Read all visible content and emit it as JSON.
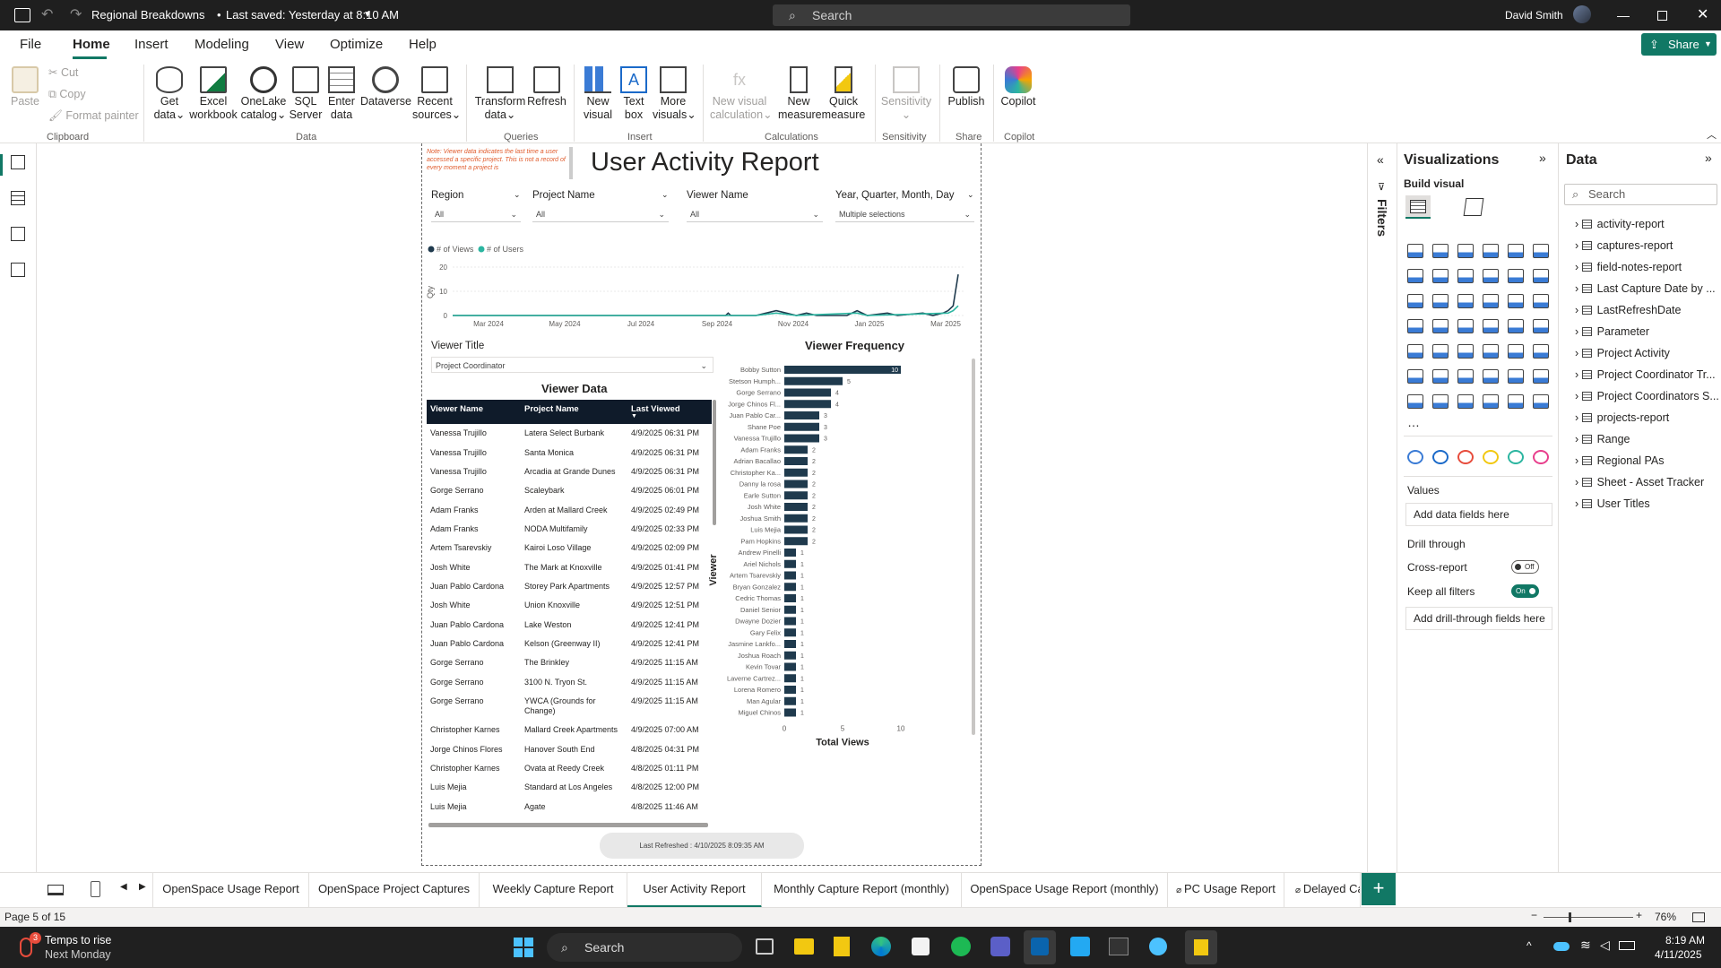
{
  "app": {
    "file_title": "Regional Breakdowns",
    "saved_status": "Last saved: Yesterday at 8:10 AM",
    "search_placeholder": "Search",
    "user_name": "David Smith",
    "share_label": "Share"
  },
  "menu": [
    "File",
    "Home",
    "Insert",
    "Modeling",
    "View",
    "Optimize",
    "Help"
  ],
  "ribbon": {
    "clipboard": {
      "paste": "Paste",
      "cut": "Cut",
      "copy": "Copy",
      "format_painter": "Format painter",
      "group": "Clipboard"
    },
    "data": {
      "get_data": [
        "Get",
        "data"
      ],
      "excel": [
        "Excel",
        "workbook"
      ],
      "onelake": [
        "OneLake",
        "catalog"
      ],
      "sql": [
        "SQL",
        "Server"
      ],
      "enter": [
        "Enter",
        "data"
      ],
      "dataverse": "Dataverse",
      "recent": [
        "Recent",
        "sources"
      ],
      "group": "Data"
    },
    "queries": {
      "transform": [
        "Transform",
        "data"
      ],
      "refresh": "Refresh",
      "group": "Queries"
    },
    "insert": {
      "new_visual": [
        "New",
        "visual"
      ],
      "text_box": [
        "Text",
        "box"
      ],
      "more_visuals": [
        "More",
        "visuals"
      ],
      "group": "Insert"
    },
    "calculations": {
      "new_visual_calc": [
        "New visual",
        "calculation"
      ],
      "new_measure": [
        "New",
        "measure"
      ],
      "quick_measure": [
        "Quick",
        "measure"
      ],
      "group": "Calculations"
    },
    "sensitivity": {
      "label": "Sensitivity",
      "group": "Sensitivity"
    },
    "share": {
      "publish": "Publish",
      "group": "Share"
    },
    "copilot": {
      "label": "Copilot",
      "group": "Copilot"
    }
  },
  "report": {
    "note": "Note: Viewer data indicates the last time a user accessed a specific project. This is not a record of every moment a project is",
    "title": "User Activity Report",
    "slicers": [
      {
        "label": "Region",
        "value": "All"
      },
      {
        "label": "Project Name",
        "value": "All"
      },
      {
        "label": "Viewer Name",
        "value": "All"
      },
      {
        "label": "Year, Quarter, Month, Day",
        "value": "Multiple selections"
      }
    ],
    "viewer_title": {
      "label": "Viewer Title",
      "value": "Project Coordinator"
    },
    "last_refreshed": "Last Refreshed : 4/10/2025 8:09:35 AM"
  },
  "chart_data": [
    {
      "type": "line",
      "legend": [
        "# of Views",
        "# of Users"
      ],
      "ylabel": "Qty",
      "ylim": [
        0,
        20
      ],
      "yticks": [
        "20",
        "10",
        "0"
      ],
      "xticks": [
        "Mar 2024",
        "May 2024",
        "Jul 2024",
        "Sep 2024",
        "Nov 2024",
        "Jan 2025",
        "Mar 2025"
      ],
      "series": [
        {
          "name": "# of Views",
          "color": "#1f3a4d",
          "points": [
            [
              0,
              0
            ],
            [
              0.54,
              0
            ],
            [
              0.545,
              1
            ],
            [
              0.55,
              0
            ],
            [
              0.6,
              0
            ],
            [
              0.62,
              1
            ],
            [
              0.64,
              2
            ],
            [
              0.66,
              1
            ],
            [
              0.68,
              0
            ],
            [
              0.7,
              1
            ],
            [
              0.72,
              0
            ],
            [
              0.78,
              0
            ],
            [
              0.8,
              2
            ],
            [
              0.82,
              0
            ],
            [
              0.86,
              1
            ],
            [
              0.88,
              0
            ],
            [
              0.93,
              1
            ],
            [
              0.95,
              0
            ],
            [
              0.97,
              1
            ],
            [
              0.98,
              2
            ],
            [
              0.99,
              4
            ],
            [
              1.0,
              17
            ]
          ]
        },
        {
          "name": "# of Users",
          "color": "#2bb5a0",
          "points": [
            [
              0,
              0
            ],
            [
              0.6,
              0
            ],
            [
              0.64,
              1
            ],
            [
              0.68,
              0
            ],
            [
              0.8,
              1
            ],
            [
              0.82,
              0
            ],
            [
              0.98,
              1
            ],
            [
              0.99,
              2
            ],
            [
              1.0,
              4
            ]
          ]
        }
      ]
    },
    {
      "type": "bar",
      "title": "Viewer Frequency",
      "xlabel": "Total Views",
      "ylabel": "Viewer",
      "xlim": [
        0,
        10
      ],
      "xticks": [
        "0",
        "5",
        "10"
      ],
      "categories": [
        "Bobby Sutton",
        "Stetson Humph...",
        "Gorge Serrano",
        "Jorge Chinos Fl...",
        "Juan Pablo Car...",
        "Shane Poe",
        "Vanessa Trujillo",
        "Adam Franks",
        "Adrian Bacallao",
        "Christopher Ka...",
        "Danny la rosa",
        "Earle Sutton",
        "Josh White",
        "Joshua Smith",
        "Luis Mejia",
        "Pam Hopkins",
        "Andrew Pinelli",
        "Ariel Nichols",
        "Artem Tsarevskiy",
        "Bryan Gonzalez",
        "Cedric Thomas",
        "Daniel Senior",
        "Dwayne Dozier",
        "Gary Felix",
        "Jasmine Lankfo...",
        "Joshua Roach",
        "Kevin Tovar",
        "Laverne Cartrez...",
        "Lorena Romero",
        "Man Agular",
        "Miguel Chinos"
      ],
      "values": [
        10,
        5,
        4,
        4,
        3,
        3,
        3,
        2,
        2,
        2,
        2,
        2,
        2,
        2,
        2,
        2,
        1,
        1,
        1,
        1,
        1,
        1,
        1,
        1,
        1,
        1,
        1,
        1,
        1,
        1,
        1
      ],
      "labels": [
        "10",
        "5",
        "4",
        "4",
        "3",
        "3",
        "3",
        "2",
        "2",
        "2",
        "2",
        "2",
        "2",
        "2",
        "2",
        "2",
        "1",
        "1",
        "1",
        "1",
        "1",
        "1",
        "1",
        "1",
        "1",
        "1",
        "1",
        "1",
        "1",
        "1",
        "1"
      ]
    }
  ],
  "viewer_table": {
    "title": "Viewer Data",
    "columns": [
      "Viewer Name",
      "Project Name",
      "Last Viewed"
    ],
    "rows": [
      [
        "Vanessa Trujillo",
        "Latera Select Burbank",
        "4/9/2025 06:31 PM"
      ],
      [
        "Vanessa Trujillo",
        "Santa Monica",
        "4/9/2025 06:31 PM"
      ],
      [
        "Vanessa Trujillo",
        "Arcadia at Grande Dunes",
        "4/9/2025 06:31 PM"
      ],
      [
        "Gorge Serrano",
        "Scaleybark",
        "4/9/2025 06:01 PM"
      ],
      [
        "Adam Franks",
        "Arden at Mallard Creek",
        "4/9/2025 02:49 PM"
      ],
      [
        "Adam Franks",
        "NODA Multifamily",
        "4/9/2025 02:33 PM"
      ],
      [
        "Artem Tsarevskiy",
        "Kairoi Loso Village",
        "4/9/2025 02:09 PM"
      ],
      [
        "Josh White",
        "The Mark at Knoxville",
        "4/9/2025 01:41 PM"
      ],
      [
        "Juan Pablo Cardona",
        "Storey Park Apartments",
        "4/9/2025 12:57 PM"
      ],
      [
        "Josh White",
        "Union Knoxville",
        "4/9/2025 12:51 PM"
      ],
      [
        "Juan Pablo Cardona",
        "Lake Weston",
        "4/9/2025 12:41 PM"
      ],
      [
        "Juan Pablo Cardona",
        "Kelson (Greenway II)",
        "4/9/2025 12:41 PM"
      ],
      [
        "Gorge Serrano",
        "The Brinkley",
        "4/9/2025 11:15 AM"
      ],
      [
        "Gorge Serrano",
        "3100 N. Tryon St.",
        "4/9/2025 11:15 AM"
      ],
      [
        "Gorge Serrano",
        "YWCA (Grounds for Change)",
        "4/9/2025 11:15 AM"
      ],
      [
        "Christopher Karnes",
        "Mallard Creek Apartments",
        "4/9/2025 07:00 AM"
      ],
      [
        "Jorge Chinos Flores",
        "Hanover South End",
        "4/8/2025 04:31 PM"
      ],
      [
        "Christopher Karnes",
        "Ovata at Reedy Creek",
        "4/8/2025 01:11 PM"
      ],
      [
        "Luis Mejia",
        "Standard at Los Angeles",
        "4/8/2025 12:00 PM"
      ],
      [
        "Luis Mejia",
        "Agate",
        "4/8/2025 11:46 AM"
      ]
    ]
  },
  "panes": {
    "filters": "Filters",
    "visualizations": {
      "title": "Visualizations",
      "build_visual": "Build visual",
      "values": "Values",
      "add_data": "Add data fields here",
      "drill_through": "Drill through",
      "cross_report": "Cross-report",
      "cross_report_state": "Off",
      "keep_filters": "Keep all filters",
      "keep_filters_state": "On",
      "add_drill": "Add drill-through fields here"
    },
    "data": {
      "title": "Data",
      "search_placeholder": "Search",
      "tables": [
        "activity-report",
        "captures-report",
        "field-notes-report",
        "Last Capture Date by ...",
        "LastRefreshDate",
        "Parameter",
        "Project Activity",
        "Project Coordinator Tr...",
        "Project Coordinators S...",
        "projects-report",
        "Range",
        "Regional PAs",
        "Sheet - Asset Tracker",
        "User Titles"
      ]
    }
  },
  "tabs": [
    "OpenSpace Usage Report",
    "OpenSpace Project Captures",
    "Weekly Capture Report",
    "User Activity Report",
    "Monthly Capture Report (monthly)",
    "OpenSpace Usage Report (monthly)",
    "PC Usage Report",
    "Delayed Ca"
  ],
  "status": {
    "page": "Page 5 of 15",
    "zoom": "76%"
  },
  "taskbar": {
    "weather_title": "Temps to rise",
    "weather_sub": "Next Monday",
    "search": "Search",
    "time": "8:19 AM",
    "date": "4/11/2025",
    "badge": "3"
  }
}
